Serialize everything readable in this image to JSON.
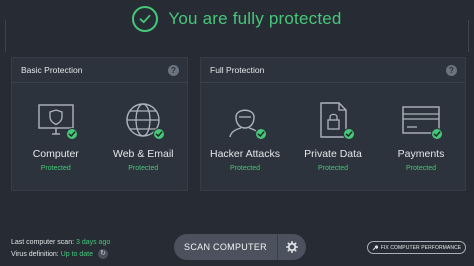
{
  "header": {
    "title": "You are fully protected",
    "icon": "check-circle-icon"
  },
  "colors": {
    "accent": "#45c77a",
    "background": "#272c34",
    "panel": "#2d333c"
  },
  "basic_protection": {
    "title": "Basic Protection",
    "help": "?",
    "items": [
      {
        "label": "Computer",
        "status": "Protected",
        "icon": "monitor-shield-icon"
      },
      {
        "label": "Web & Email",
        "status": "Protected",
        "icon": "globe-icon"
      }
    ]
  },
  "full_protection": {
    "title": "Full Protection",
    "help": "?",
    "items": [
      {
        "label": "Hacker Attacks",
        "status": "Protected",
        "icon": "hacker-icon"
      },
      {
        "label": "Private Data",
        "status": "Protected",
        "icon": "lock-document-icon"
      },
      {
        "label": "Payments",
        "status": "Protected",
        "icon": "credit-card-icon"
      }
    ]
  },
  "status": {
    "last_scan_label": "Last computer scan:",
    "last_scan_value": "3 days ago",
    "virus_def_label": "Virus definition:",
    "virus_def_value": "Up to date"
  },
  "scan": {
    "label": "SCAN COMPUTER",
    "icon": "gear-icon"
  },
  "fix": {
    "label": "FIX COMPUTER PERFORMANCE",
    "icon": "wrench-icon"
  }
}
